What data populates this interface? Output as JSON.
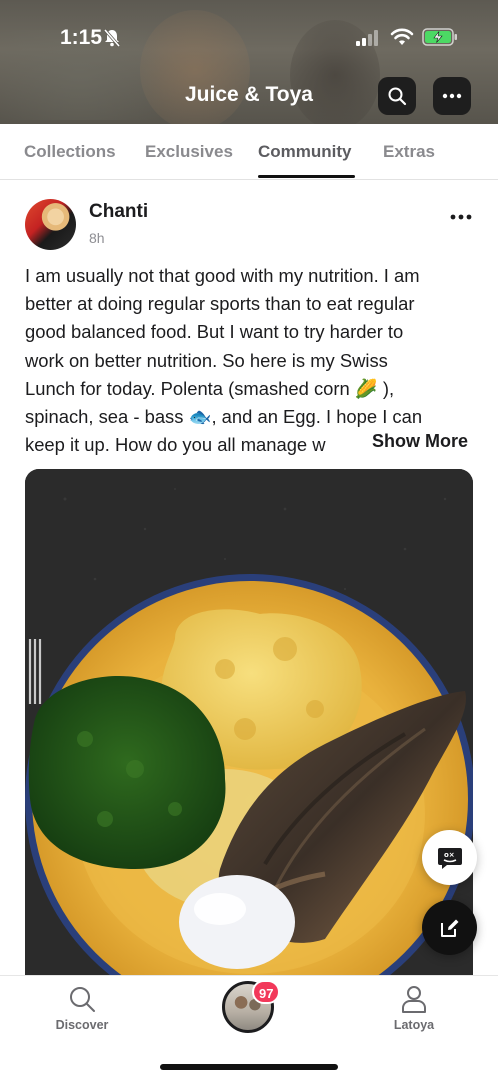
{
  "status_bar": {
    "time": "1:15"
  },
  "header": {
    "title": "Juice & Toya"
  },
  "tabs": [
    {
      "label": "Collections",
      "active": false
    },
    {
      "label": "Exclusives",
      "active": false
    },
    {
      "label": "Community",
      "active": true
    },
    {
      "label": "Extras",
      "active": false
    }
  ],
  "post": {
    "author": "Chanti",
    "time": "8h",
    "text_lines": [
      "I am usually not that good with my nutrition. I am",
      "better at doing regular sports than to eat regular",
      "good balanced food. But I want to try harder to",
      "work on better nutrition. So here is my Swiss",
      "Lunch for today. Polenta (smashed corn 🌽 ),",
      "spinach, sea - bass 🐟, and an Egg. I hope I can",
      "keep it up. How do you all manage w"
    ],
    "show_more_label": "Show More"
  },
  "bottom_nav": {
    "discover_label": "Discover",
    "badge_count": "97",
    "profile_label": "Latoya"
  },
  "colors": {
    "badge": "#f2385a",
    "header_button": "#1e1e1e",
    "compose_button": "#111111"
  }
}
